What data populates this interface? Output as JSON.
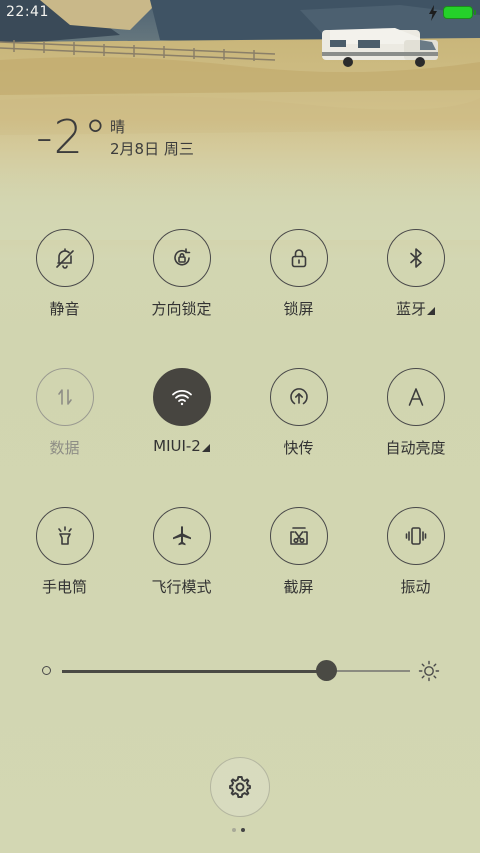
{
  "status_bar": {
    "time": "22:41",
    "battery_icon": "battery-full-icon",
    "charging_icon": "lightning-icon"
  },
  "weather": {
    "temperature": "-2°",
    "condition": "晴",
    "date": "2月8日 周三"
  },
  "toggles": [
    {
      "label": "静音",
      "icon": "bell-off-icon",
      "active": false,
      "disabled": false
    },
    {
      "label": "方向锁定",
      "icon": "rotation-lock-icon",
      "active": false,
      "disabled": false
    },
    {
      "label": "锁屏",
      "icon": "lock-icon",
      "active": false,
      "disabled": false
    },
    {
      "label": "蓝牙",
      "icon": "bluetooth-icon",
      "active": false,
      "disabled": false,
      "has_more": true
    },
    {
      "label": "数据",
      "icon": "mobile-data-icon",
      "active": false,
      "disabled": true
    },
    {
      "label": "MIUI-2",
      "icon": "wifi-icon",
      "active": true,
      "disabled": false,
      "has_more": true
    },
    {
      "label": "快传",
      "icon": "transfer-icon",
      "active": false,
      "disabled": false
    },
    {
      "label": "自动亮度",
      "icon": "auto-brightness-icon",
      "active": false,
      "disabled": false
    },
    {
      "label": "手电筒",
      "icon": "flashlight-icon",
      "active": false,
      "disabled": false
    },
    {
      "label": "飞行模式",
      "icon": "airplane-icon",
      "active": false,
      "disabled": false
    },
    {
      "label": "截屏",
      "icon": "screenshot-icon",
      "active": false,
      "disabled": false
    },
    {
      "label": "振动",
      "icon": "vibrate-icon",
      "active": false,
      "disabled": false
    }
  ],
  "brightness": {
    "level": 0.76,
    "min_icon": "dim-sun-icon",
    "max_icon": "bright-sun-icon"
  },
  "settings": {
    "icon": "gear-icon"
  },
  "pager": {
    "pages": 2,
    "current": 2
  },
  "colors": {
    "active_toggle": "#474540",
    "background": "#d3d7b3",
    "battery": "#25d12a"
  }
}
